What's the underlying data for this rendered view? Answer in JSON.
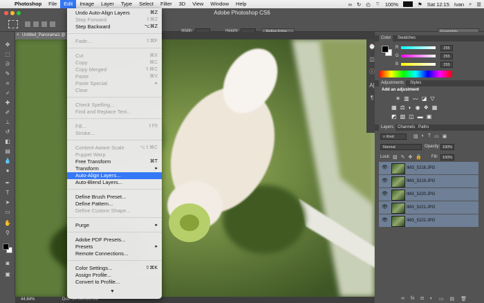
{
  "menubar": {
    "app": "Photoshop",
    "items": [
      "File",
      "Edit",
      "Image",
      "Layer",
      "Type",
      "Select",
      "Filter",
      "3D",
      "View",
      "Window",
      "Help"
    ],
    "active": "Edit",
    "battery": "100%",
    "clock": "Sat 12:15",
    "user": "Ivan"
  },
  "window_title": "Adobe Photoshop CS6",
  "options": {
    "width_label": "Width:",
    "height_label": "Height:",
    "refine_edge": "Refine Edge...",
    "workspace": "Essentials"
  },
  "document": {
    "tab": "Untitled_Panorama1 @",
    "zoom": "44.64%",
    "doc_info": "Doc: 34.5M/180.3M"
  },
  "edit_menu": [
    {
      "label": "Undo Auto-Align Layers",
      "shortcut": "⌘Z",
      "disabled": false
    },
    {
      "label": "Step Forward",
      "shortcut": "⇧⌘Z",
      "disabled": true
    },
    {
      "label": "Step Backward",
      "shortcut": "⌥⌘Z",
      "disabled": false
    },
    {
      "sep": true
    },
    {
      "label": "Fade...",
      "shortcut": "⇧⌘F",
      "disabled": true
    },
    {
      "sep": true
    },
    {
      "label": "Cut",
      "shortcut": "⌘X",
      "disabled": true
    },
    {
      "label": "Copy",
      "shortcut": "⌘C",
      "disabled": true
    },
    {
      "label": "Copy Merged",
      "shortcut": "⇧⌘C",
      "disabled": true
    },
    {
      "label": "Paste",
      "shortcut": "⌘V",
      "disabled": true
    },
    {
      "label": "Paste Special",
      "shortcut": "▸",
      "disabled": true
    },
    {
      "label": "Clear",
      "shortcut": "",
      "disabled": true
    },
    {
      "sep": true
    },
    {
      "label": "Check Spelling...",
      "shortcut": "",
      "disabled": true
    },
    {
      "label": "Find and Replace Text...",
      "shortcut": "",
      "disabled": true
    },
    {
      "sep": true
    },
    {
      "label": "Fill...",
      "shortcut": "⇧F5",
      "disabled": true
    },
    {
      "label": "Stroke...",
      "shortcut": "",
      "disabled": true
    },
    {
      "sep": true
    },
    {
      "label": "Content-Aware Scale",
      "shortcut": "⌥⇧⌘C",
      "disabled": true
    },
    {
      "label": "Puppet Warp",
      "shortcut": "",
      "disabled": true
    },
    {
      "label": "Free Transform",
      "shortcut": "⌘T",
      "disabled": false
    },
    {
      "label": "Transform",
      "shortcut": "▸",
      "disabled": false
    },
    {
      "label": "Auto-Align Layers...",
      "shortcut": "",
      "disabled": false,
      "highlight": true
    },
    {
      "label": "Auto-Blend Layers...",
      "shortcut": "",
      "disabled": false
    },
    {
      "sep": true
    },
    {
      "label": "Define Brush Preset...",
      "shortcut": "",
      "disabled": false
    },
    {
      "label": "Define Pattern...",
      "shortcut": "",
      "disabled": false
    },
    {
      "label": "Define Custom Shape...",
      "shortcut": "",
      "disabled": true
    },
    {
      "sep": true
    },
    {
      "label": "Purge",
      "shortcut": "▸",
      "disabled": false
    },
    {
      "sep": true
    },
    {
      "label": "Adobe PDF Presets...",
      "shortcut": "",
      "disabled": false
    },
    {
      "label": "Presets",
      "shortcut": "▸",
      "disabled": false
    },
    {
      "label": "Remote Connections...",
      "shortcut": "",
      "disabled": false
    },
    {
      "sep": true
    },
    {
      "label": "Color Settings...",
      "shortcut": "⇧⌘K",
      "disabled": false
    },
    {
      "label": "Assign Profile...",
      "shortcut": "",
      "disabled": false
    },
    {
      "label": "Convert to Profile...",
      "shortcut": "",
      "disabled": false
    }
  ],
  "color_panel": {
    "tabs": [
      "Color",
      "Swatches"
    ],
    "r": "255",
    "g": "255",
    "b": "255"
  },
  "adjustments_panel": {
    "tabs": [
      "Adjustments",
      "Styles"
    ],
    "heading": "Add an adjustment"
  },
  "layers_panel": {
    "tabs": [
      "Layers",
      "Channels",
      "Paths"
    ],
    "kind": "Kind",
    "blend_mode": "Normal",
    "opacity_label": "Opacity:",
    "opacity": "100%",
    "lock_label": "Lock:",
    "fill_label": "Fill:",
    "fill": "100%",
    "layers": [
      "IMG_5218.JPG",
      "IMG_5219.JPG",
      "IMG_5220.JPG",
      "IMG_5221.JPG",
      "IMG_5222.JPG"
    ]
  }
}
